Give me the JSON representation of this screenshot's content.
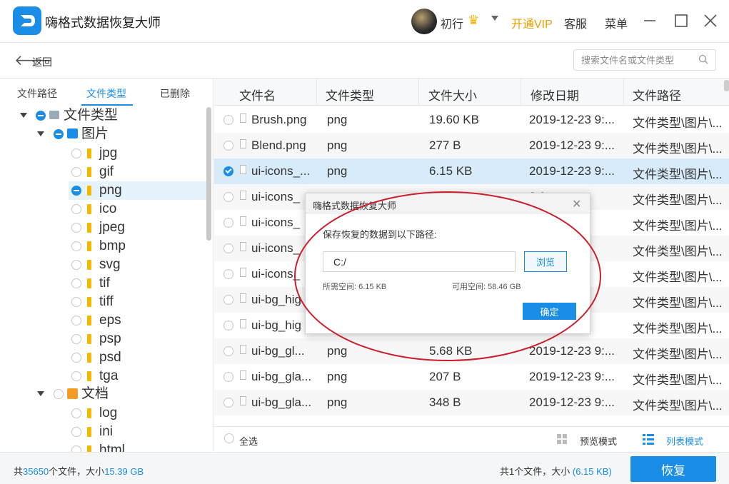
{
  "app": {
    "title": "嗨格式数据恢复大师"
  },
  "user": {
    "name": "初行",
    "vip_label": "开通VIP",
    "service_label": "客服",
    "menu_label": "菜单"
  },
  "toolbar": {
    "back_label": "返回",
    "search_placeholder": "搜索文件名或文件类型"
  },
  "sidebar": {
    "tabs": [
      {
        "label": "文件路径"
      },
      {
        "label": "文件类型"
      },
      {
        "label": "已删除"
      }
    ],
    "active_tab": "文件类型",
    "root": "文件类型",
    "images_group": "图片",
    "image_types": [
      "jpg",
      "gif",
      "png",
      "ico",
      "jpeg",
      "bmp",
      "svg",
      "tif",
      "tiff",
      "eps",
      "psp",
      "psd",
      "tga"
    ],
    "selected_type": "png",
    "docs_group": "文档",
    "doc_types": [
      "log",
      "ini",
      "html"
    ]
  },
  "table": {
    "headers": [
      "文件名",
      "文件类型",
      "文件大小",
      "修改日期",
      "文件路径"
    ],
    "rows": [
      {
        "name": "Brush.png",
        "type": "png",
        "size": "19.60 KB",
        "date": "2019-12-23 9:...",
        "path": "文件类型\\图片\\..."
      },
      {
        "name": "Blend.png",
        "type": "png",
        "size": "277 B",
        "date": "2019-12-23 9:...",
        "path": "文件类型\\图片\\..."
      },
      {
        "name": "ui-icons_...",
        "type": "png",
        "size": "6.15 KB",
        "date": "2019-12-23 9:...",
        "path": "文件类型\\图片\\..."
      },
      {
        "name": "ui-icons_",
        "type": "",
        "size": "",
        "date": "3 9:...",
        "path": "文件类型\\图片\\..."
      },
      {
        "name": "ui-icons_",
        "type": "",
        "size": "",
        "date": "3 9:...",
        "path": "文件类型\\图片\\..."
      },
      {
        "name": "ui-icons_",
        "type": "",
        "size": "",
        "date": "3 9:...",
        "path": "文件类型\\图片\\..."
      },
      {
        "name": "ui-icons_",
        "type": "",
        "size": "",
        "date": "3 9:...",
        "path": "文件类型\\图片\\..."
      },
      {
        "name": "ui-bg_hig",
        "type": "",
        "size": "",
        "date": "3 9:...",
        "path": "文件类型\\图片\\..."
      },
      {
        "name": "ui-bg_hig",
        "type": "",
        "size": "",
        "date": "3 9:...",
        "path": "文件类型\\图片\\..."
      },
      {
        "name": "ui-bg_gl...",
        "type": "png",
        "size": "5.68 KB",
        "date": "2019-12-23 9:...",
        "path": "文件类型\\图片\\..."
      },
      {
        "name": "ui-bg_gla...",
        "type": "png",
        "size": "207 B",
        "date": "2019-12-23 9:...",
        "path": "文件类型\\图片\\..."
      },
      {
        "name": "ui-bg_gla...",
        "type": "png",
        "size": "348 B",
        "date": "2019-12-23 9:...",
        "path": "文件类型\\图片\\..."
      }
    ],
    "selected_row": 2
  },
  "footer": {
    "select_all": "全选",
    "preview_mode": "预览模式",
    "list_mode": "列表模式"
  },
  "status": {
    "prefix": "共",
    "total_count": "35650",
    "count_suffix": "个文件，大小",
    "total_size": "15.39 GB",
    "selected_prefix": "共1个文件，大小",
    "selected_size": "(6.15 KB)",
    "restore_label": "恢复"
  },
  "dialog": {
    "title": "嗨格式数据恢复大师",
    "prompt": "保存恢复的数据到以下路径:",
    "path_value": "C:/",
    "browse_label": "浏览",
    "required_label": "所需空间:",
    "required_value": "6.15 KB",
    "available_label": "可用空间:",
    "available_value": "58.46 GB",
    "ok_label": "确定"
  },
  "colors": {
    "accent": "#1a8ee6",
    "vip": "#e8a000",
    "annotation": "#cc1f2e"
  }
}
